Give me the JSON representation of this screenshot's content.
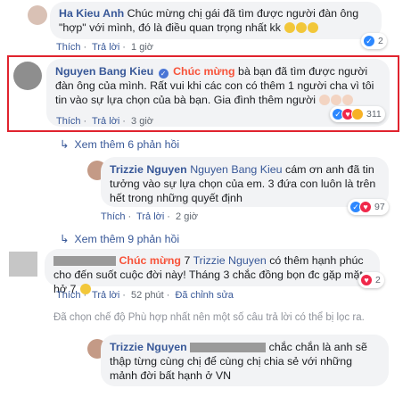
{
  "c1": {
    "name": "Ha Kieu Anh",
    "text": "Chúc mừng chị gái đã tìm được người đàn ông \"hợp\" với mình, đó là điều quan trọng nhất kk",
    "reactions": "2",
    "actions": {
      "like": "Thích",
      "reply": "Trả lời",
      "time": "1 giờ"
    }
  },
  "c2": {
    "name": "Nguyen Bang Kieu",
    "highlight": "Chúc mừng",
    "text": " bà bạn đã tìm được người đàn ông của mình. Rất vui khi các con có thêm 1 người cha vì tôi tin vào sự lựa chọn của bà bạn. Gia đình thêm người",
    "reactions": "311",
    "actions": {
      "like": "Thích",
      "reply": "Trả lời",
      "time": "3 giờ"
    }
  },
  "more1": "Xem thêm 6 phản hồi",
  "c3": {
    "name": "Trizzie Nguyen",
    "mention": "Nguyen Bang Kieu",
    "text": " cám ơn anh đã tin tưởng vào sự lựa chọn của em. 3 đứa con luôn là trên hết trong những quyết định",
    "reactions": "97",
    "actions": {
      "like": "Thích",
      "reply": "Trả lời",
      "time": "2 giờ"
    }
  },
  "more2": "Xem thêm 9 phản hồi",
  "c4": {
    "highlight": "Chúc mừng",
    "number": "7",
    "mention": "Trizzie Nguyen",
    "text": " có thêm hạnh phúc cho đến suốt cuộc đời này! Tháng 3 chắc đồng bọn đc gặp mặt hở 7",
    "reactions": "2",
    "actions": {
      "like": "Thích",
      "reply": "Trả lời",
      "time": "52 phút",
      "edited": "Đã chỉnh sửa"
    }
  },
  "notice": "Đã chọn chế độ Phù hợp nhất nên một số câu trả lời có thể bị lọc ra.",
  "c5": {
    "name": "Trizzie Nguyen",
    "text": " chắc chắn là anh sẽ thập từng cùng chị để cùng chị chia sẻ với những mảnh đời bất hạnh ở VN"
  },
  "colors": {
    "link": "#385898",
    "accent": "#f7533a",
    "highlight_border": "#e0232e",
    "bubble": "#f2f3f5"
  }
}
